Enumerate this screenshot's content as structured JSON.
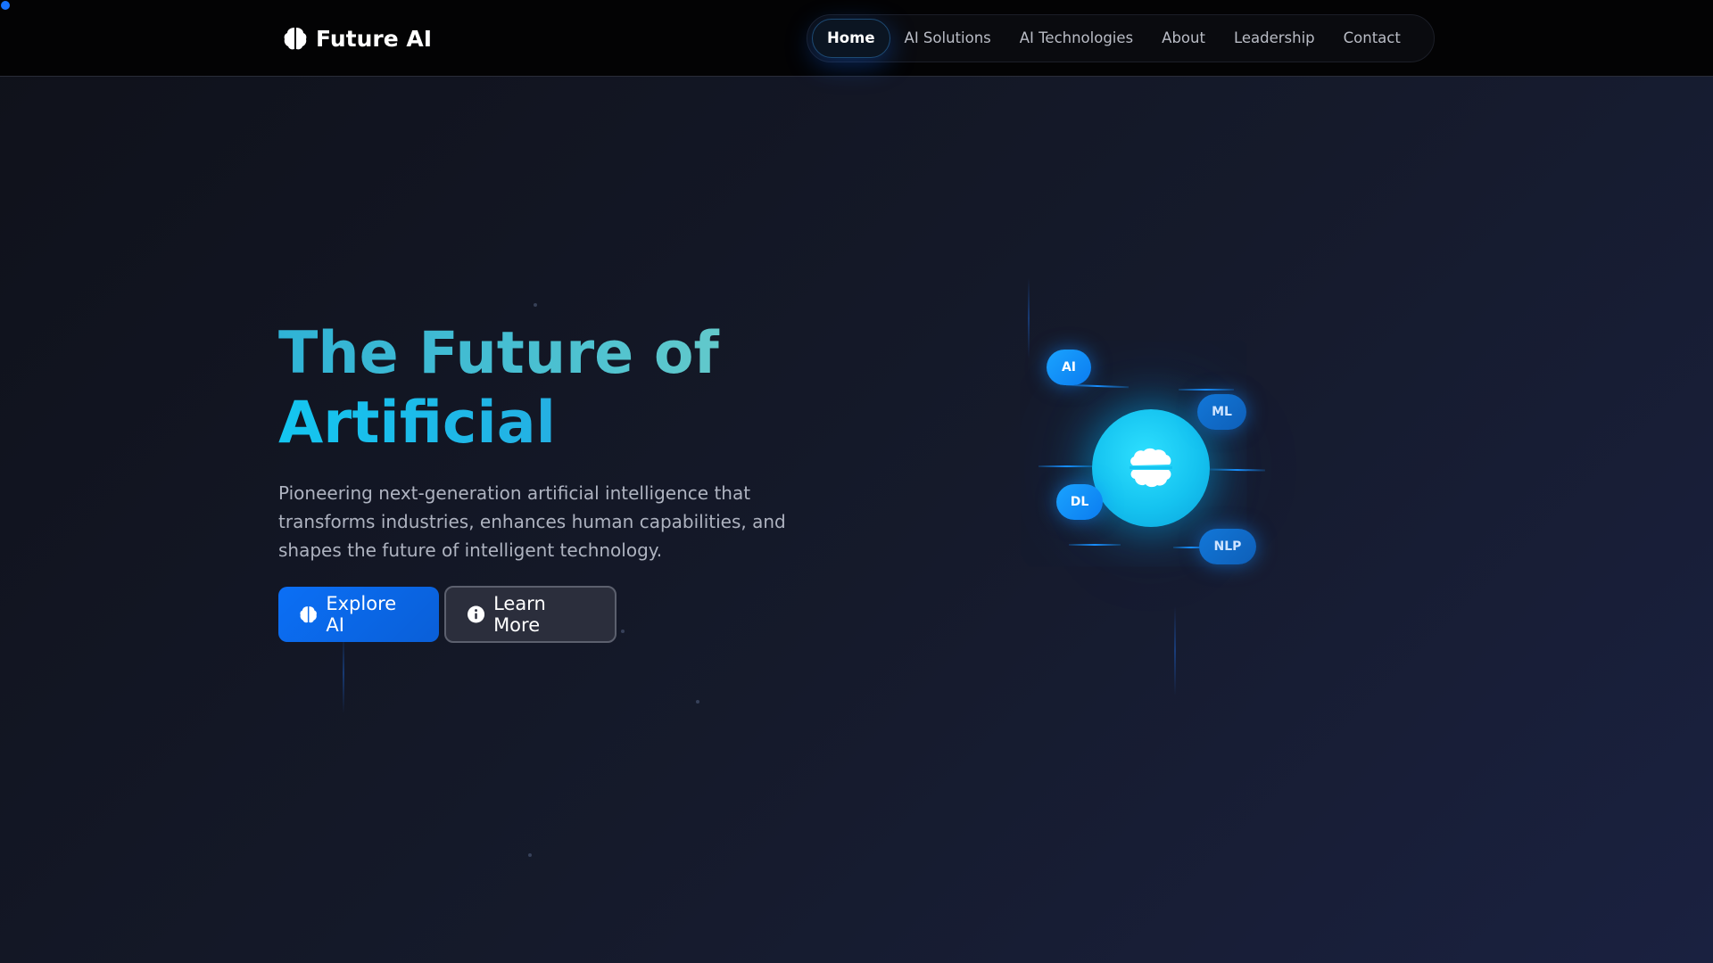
{
  "brand": {
    "name": "Future AI",
    "icon": "brain-icon"
  },
  "nav": {
    "items": [
      {
        "label": "Home",
        "active": true
      },
      {
        "label": "AI Solutions",
        "active": false
      },
      {
        "label": "AI Technologies",
        "active": false
      },
      {
        "label": "About",
        "active": false
      },
      {
        "label": "Leadership",
        "active": false
      },
      {
        "label": "Contact",
        "active": false
      }
    ]
  },
  "hero": {
    "title_line1": "The Future of",
    "title_line2": "Artificial",
    "subtitle": "Pioneering next-generation artificial intelligence that transforms industries, enhances human capabilities, and shapes the future of intelligent technology.",
    "primary_button": {
      "label": "Explore AI",
      "icon": "brain-icon"
    },
    "secondary_button": {
      "label": "Learn More",
      "icon": "info-circle-icon"
    }
  },
  "visual": {
    "core_icon": "brain-icon",
    "chips": {
      "ai": "AI",
      "ml": "ML",
      "dl": "DL",
      "nlp": "NLP"
    }
  },
  "colors": {
    "accent": "#0b6ff5",
    "cyan": "#15c3f0",
    "background": "#151a2b",
    "navbar": "#030304"
  }
}
